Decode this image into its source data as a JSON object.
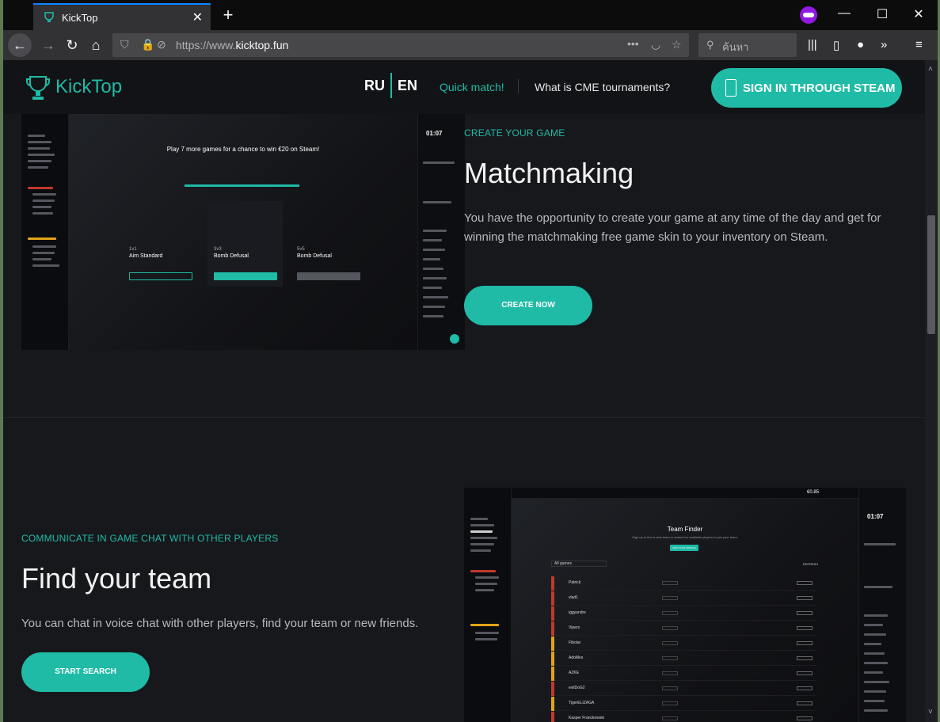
{
  "browser": {
    "tab_title": "KickTop",
    "tab_close": "✕",
    "new_tab": "+",
    "url_prefix": "https://www.",
    "url_domain": "kicktop.fun",
    "search_placeholder": "ค้นหา",
    "url_actions": "•••",
    "window_controls": {
      "minimize": "—",
      "maximize": "☐",
      "close": "✕"
    }
  },
  "header": {
    "logo_text": "KickTop",
    "lang_ru": "RU",
    "lang_en": "EN",
    "nav_quick_match": "Quick match!",
    "nav_what": "What is CME tournaments?",
    "steam_button": "SIGN IN THROUGH STEAM"
  },
  "section_matchmaking": {
    "eyebrow": "CREATE YOUR GAME",
    "title": "Matchmaking",
    "text": "You have the opportunity to create your game at any time of the day and get for winning the matchmaking free game skin to your inventory on Steam.",
    "cta": "CREATE NOW",
    "screenshot": {
      "headline": "Play 7 more games for a chance to win €20 on Steam!",
      "timer": "01:07",
      "modes": [
        {
          "mode": "1v1",
          "name": "Aim Standard",
          "button": "FIND GAME"
        },
        {
          "mode": "3v3",
          "name": "Bomb Defusal",
          "button": "FINDING GAME 37:07"
        },
        {
          "mode": "5v5",
          "name": "Bomb Defusal",
          "button": "CREATE GAME"
        }
      ]
    }
  },
  "section_team": {
    "eyebrow": "COMMUNICATE IN GAME CHAT WITH OTHER PLAYERS",
    "title": "Find your team",
    "text": "You can chat in voice chat with other players, find your team or new friends.",
    "cta": "START SEARCH",
    "screenshot": {
      "title": "Team Finder",
      "subtitle": "Sign up to find a new team or search for available players to join your team.",
      "button": "ADD YOUR PROFILE",
      "filter": "All games",
      "refresh": "REFRESH",
      "timer": "01:07",
      "balance": "€0.85",
      "players": [
        "Patrick",
        "vlad1",
        "iggyandre",
        "Vipers",
        "Fibolar",
        "AdoMes",
        "AZKE",
        "evilDoG2",
        "TigerELIZAGA",
        "Kasper Franckowski"
      ]
    }
  },
  "colors": {
    "accent": "#1fbba6",
    "background": "#17181c",
    "header": "#121316"
  },
  "icons": [
    "trophy-icon",
    "steam-icon",
    "search-icon",
    "star-icon",
    "reload-icon",
    "home-icon",
    "shield-icon",
    "lock-icon",
    "private-mask-icon"
  ]
}
